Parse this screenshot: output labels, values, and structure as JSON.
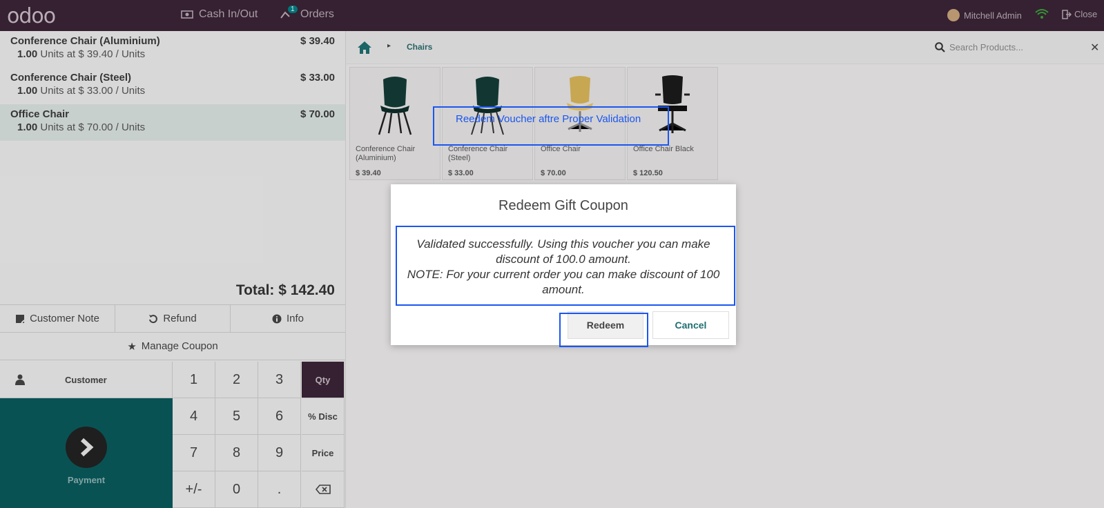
{
  "topbar": {
    "logo": "odoo",
    "cash_label": "Cash In/Out",
    "orders_label": "Orders",
    "orders_badge": "1",
    "user_name": "Mitchell Admin",
    "close_label": "Close"
  },
  "order": {
    "lines": [
      {
        "name": "Conference Chair (Aluminium)",
        "price": "$ 39.40",
        "qty": "1.00",
        "info": " Units at $ 39.40 / Units"
      },
      {
        "name": "Conference Chair (Steel)",
        "price": "$ 33.00",
        "qty": "1.00",
        "info": " Units at $ 33.00 / Units"
      },
      {
        "name": "Office Chair",
        "price": "$ 70.00",
        "qty": "1.00",
        "info": " Units at $ 70.00 / Units"
      }
    ],
    "total": "Total: $ 142.40"
  },
  "controls": {
    "customer_note": "Customer Note",
    "refund": "Refund",
    "info": "Info",
    "manage_coupon": "Manage Coupon"
  },
  "numpad": {
    "customer": "Customer",
    "payment": "Payment",
    "keys": [
      "1",
      "2",
      "3",
      "4",
      "5",
      "6",
      "7",
      "8",
      "9",
      "+/-",
      "0",
      "."
    ],
    "modes": [
      "Qty",
      "% Disc",
      "Price"
    ]
  },
  "products_panel": {
    "breadcrumb": "Chairs",
    "search_placeholder": "Search Products...",
    "products": [
      {
        "name": "Conference Chair (Aluminium)",
        "price": "$ 39.40"
      },
      {
        "name": "Conference Chair (Steel)",
        "price": "$ 33.00"
      },
      {
        "name": "Office Chair",
        "price": "$ 70.00"
      },
      {
        "name": "Office Chair Black",
        "price": "$ 120.50"
      }
    ]
  },
  "annotation": {
    "text": "Reedem Voucher aftre Proper Validation",
    "color": "#1a56f0"
  },
  "dialog": {
    "title": "Redeem Gift Coupon",
    "message_line1": "Validated successfully. Using this voucher you can make discount of 100.0 amount.",
    "message_line2": "NOTE: For your current order you can make discount of 100 amount.",
    "redeem_label": "Redeem",
    "cancel_label": "Cancel"
  },
  "colors": {
    "topbar": "#3a2436",
    "payment": "#0a5a5c",
    "accent": "#017e84"
  }
}
